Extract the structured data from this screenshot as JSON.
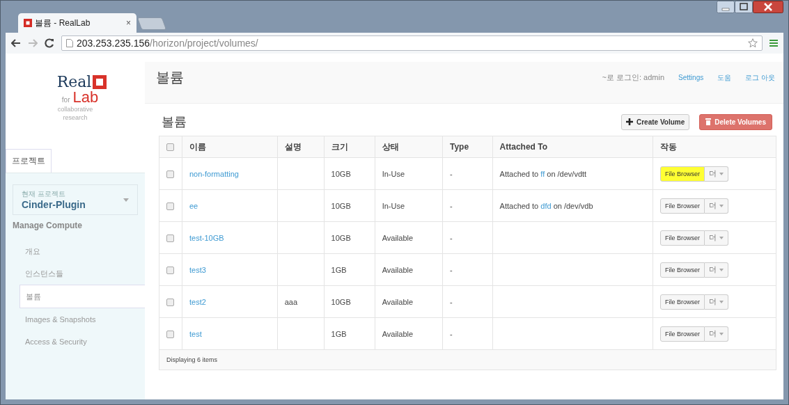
{
  "browser": {
    "tab_title": "볼륨 - RealLab",
    "tab_close": "×",
    "url_host": "203.253.235.156",
    "url_path": "/horizon/project/volumes/"
  },
  "logo": {
    "real": "Real",
    "for": "for",
    "lab": "Lab",
    "line1": "collaborative",
    "line2": "research"
  },
  "sidebar": {
    "tabs": [
      {
        "label": "프로젝트",
        "selected": true
      }
    ],
    "project": {
      "label": "현재 프로젝트",
      "value": "Cinder-Plugin"
    },
    "section": "Manage Compute",
    "items": [
      {
        "label": "개요",
        "selected": false
      },
      {
        "label": "인스턴스들",
        "selected": false
      },
      {
        "label": "볼륨",
        "selected": true
      },
      {
        "label": "Images & Snapshots",
        "selected": false
      },
      {
        "label": "Access & Security",
        "selected": false
      }
    ]
  },
  "header": {
    "title": "볼륨",
    "user": "~로 로그인: admin",
    "links": [
      "Settings",
      "도움",
      "로그 아웃"
    ]
  },
  "page": {
    "title": "볼륨",
    "create_button": "Create Volume",
    "delete_button": "Delete Volumes"
  },
  "table": {
    "columns": [
      "이름",
      "설명",
      "크기",
      "상태",
      "Type",
      "Attached To",
      "작동"
    ],
    "rows": [
      {
        "checked": false,
        "name": "non-formatting",
        "description": "",
        "size": "10GB",
        "status": "In-Use",
        "type": "-",
        "attached": {
          "prefix": "Attached to ",
          "link": "ff",
          "suffix": " on /dev/vdtt"
        },
        "action": "File Browser",
        "more": "더",
        "highlighted": true
      },
      {
        "checked": false,
        "name": "ee",
        "description": "",
        "size": "10GB",
        "status": "In-Use",
        "type": "-",
        "attached": {
          "prefix": "Attached to ",
          "link": "dfd",
          "suffix": " on /dev/vdb"
        },
        "action": "File Browser",
        "more": "더",
        "highlighted": false
      },
      {
        "checked": false,
        "name": "test-10GB",
        "description": "",
        "size": "10GB",
        "status": "Available",
        "type": "-",
        "action": "File Browser",
        "more": "더",
        "highlighted": false
      },
      {
        "checked": false,
        "name": "test3",
        "description": "",
        "size": "1GB",
        "status": "Available",
        "type": "-",
        "action": "File Browser",
        "more": "더",
        "highlighted": false
      },
      {
        "checked": false,
        "name": "test2",
        "description": "aaa",
        "size": "10GB",
        "status": "Available",
        "type": "-",
        "action": "File Browser",
        "more": "더",
        "highlighted": false
      },
      {
        "checked": false,
        "name": "test",
        "description": "",
        "size": "1GB",
        "status": "Available",
        "type": "-",
        "action": "File Browser",
        "more": "더",
        "highlighted": false
      }
    ],
    "footer": "Displaying 6 items",
    "select_all_checked": false
  }
}
